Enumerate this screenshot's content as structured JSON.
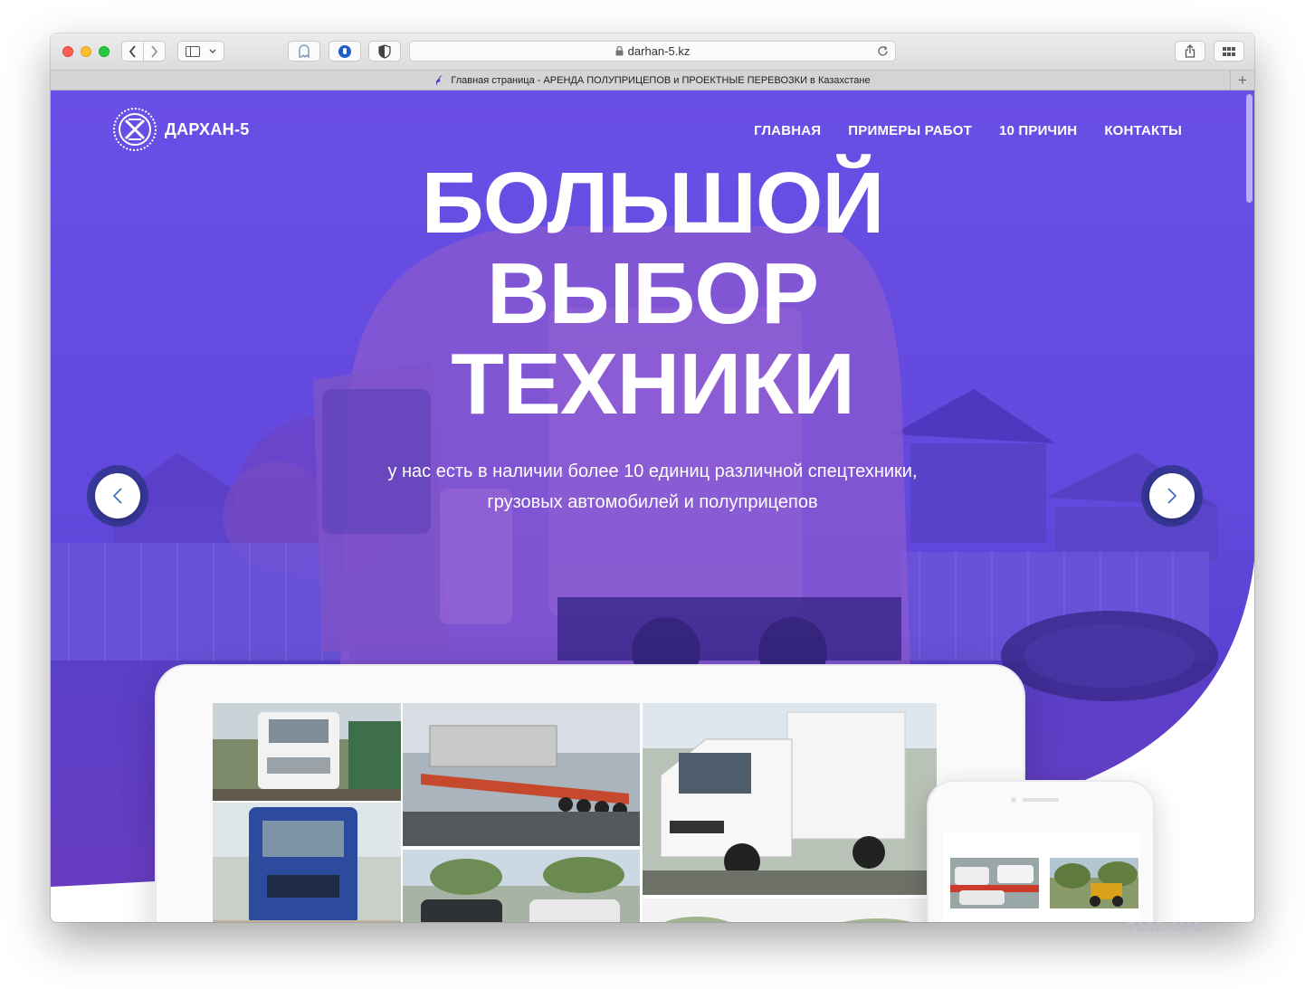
{
  "browser": {
    "url": "darhan-5.kz",
    "tab_title": "Главная страница - АРЕНДА ПОЛУПРИЦЕПОВ и ПРОЕКТНЫЕ ПЕРЕВОЗКИ в Казахстане",
    "new_tab_label": "+"
  },
  "site": {
    "logo_text": "ДАРХАН-5",
    "nav": [
      "ГЛАВНАЯ",
      "ПРИМЕРЫ РАБОТ",
      "10 ПРИЧИН",
      "КОНТАКТЫ"
    ],
    "headline_lines": [
      "БОЛЬШОЙ",
      "ВЫБОР",
      "ТЕХНИКИ"
    ],
    "subline_lines": [
      "у нас есть в наличии более 10 единиц различной спецтехники,",
      "грузовых автомобилей и полуприцепов"
    ]
  },
  "watermark": {
    "text": "TCSE-CMS",
    "sub": "ВЕБ-СТУДИЯ"
  },
  "colors": {
    "hero_overlay": "#5b3fe0",
    "hero_overlay_dark": "#3d2bb8",
    "arrow_icon": "#3a66c4"
  },
  "icons": {
    "back": "chevron-left-icon",
    "forward": "chevron-right-icon",
    "sidebar": "sidebar-icon",
    "share": "share-icon",
    "tabs": "grid-icon",
    "lock": "lock-icon",
    "reload": "reload-icon",
    "slider_prev": "chevron-left-icon",
    "slider_next": "chevron-right-icon"
  }
}
